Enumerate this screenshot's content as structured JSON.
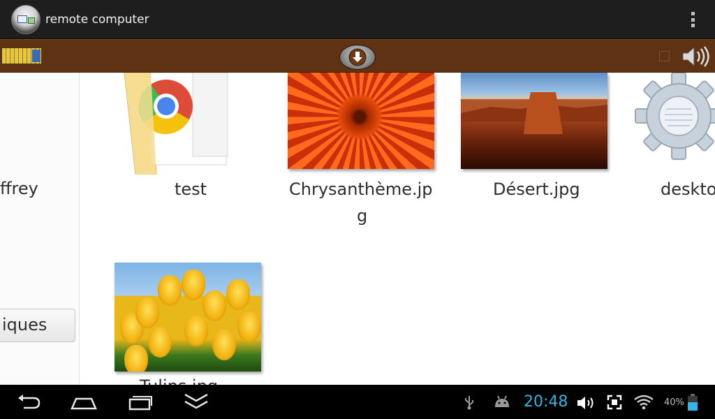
{
  "app": {
    "title": "remote computer",
    "overflow_menu_icon": "overflow-menu-icon"
  },
  "toolbar": {
    "keyboard_icon": "keyboard-icon",
    "download_icon": "download-icon",
    "speaker_icon": "speaker-icon"
  },
  "remote_desktop": {
    "side_panel": {
      "user_name_fragment": "ffrey",
      "button_label_fragment": "iques"
    },
    "files": [
      {
        "name": "test",
        "type": "folder"
      },
      {
        "name_line1": "Chrysanthème.jp",
        "name_line2": "g",
        "type": "image"
      },
      {
        "name": "Désert.jpg",
        "type": "image"
      },
      {
        "name": "deskto",
        "type": "settings-file"
      },
      {
        "name": "Tulips.jpg",
        "type": "image"
      }
    ]
  },
  "system_bar": {
    "time": "20:48",
    "battery": "40%",
    "accent_color": "#33b5e5",
    "icons": [
      "back-icon",
      "home-icon",
      "recent-apps-icon",
      "hide-keyboard-icon",
      "usb-icon",
      "android-debug-icon",
      "volume-icon",
      "screenshot-icon",
      "wifi-icon",
      "battery-icon"
    ]
  }
}
